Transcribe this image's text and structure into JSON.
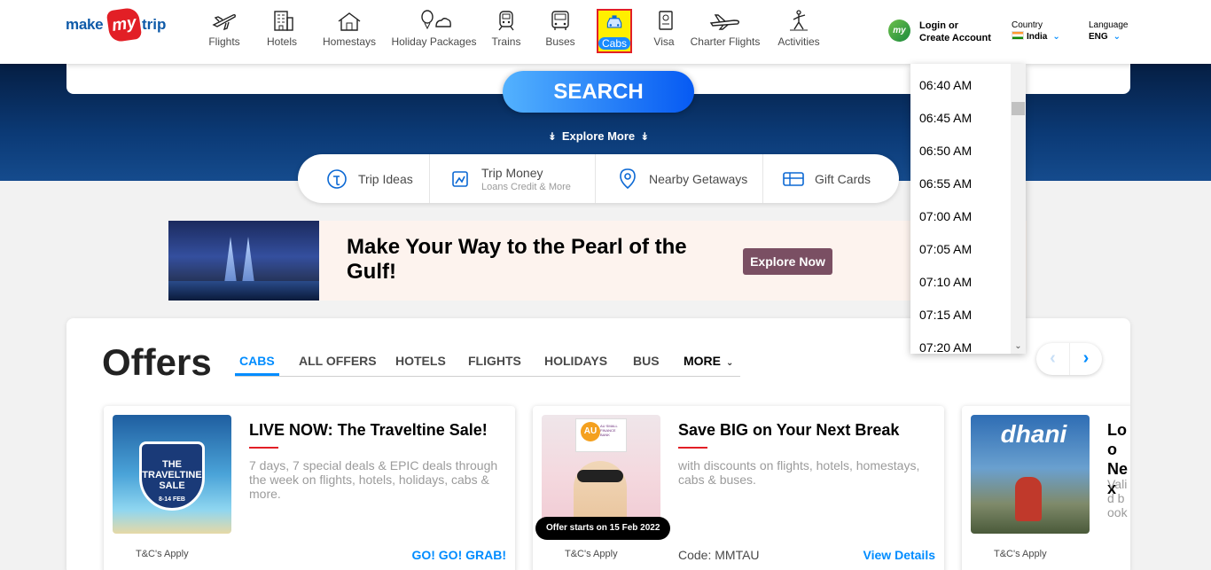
{
  "brand": {
    "make": "make",
    "my": "my",
    "trip": "trip"
  },
  "nav": [
    {
      "id": "flights",
      "label": "Flights",
      "icon": "flight-icon"
    },
    {
      "id": "hotels",
      "label": "Hotels",
      "icon": "hotel-icon"
    },
    {
      "id": "homestays",
      "label": "Homestays",
      "icon": "homestay-icon"
    },
    {
      "id": "holiday",
      "label": "Holiday Packages",
      "icon": "holiday-icon"
    },
    {
      "id": "trains",
      "label": "Trains",
      "icon": "train-icon"
    },
    {
      "id": "buses",
      "label": "Buses",
      "icon": "bus-icon"
    },
    {
      "id": "cabs",
      "label": "Cabs",
      "icon": "cab-icon"
    },
    {
      "id": "visa",
      "label": "Visa",
      "icon": "visa-icon"
    },
    {
      "id": "charter",
      "label": "Charter Flights",
      "icon": "charter-flight-icon"
    },
    {
      "id": "activities",
      "label": "Activities",
      "icon": "activities-icon"
    }
  ],
  "account": {
    "line1": "Login or",
    "line2": "Create Account",
    "avatar": "my"
  },
  "country": {
    "caption": "Country",
    "value": "India"
  },
  "language": {
    "caption": "Language",
    "value": "ENG"
  },
  "search": {
    "label": "SEARCH"
  },
  "explore": {
    "label": "Explore More"
  },
  "quick_links": [
    {
      "label": "Trip Ideas",
      "sub": ""
    },
    {
      "label": "Trip Money",
      "sub": "Loans Credit & More"
    },
    {
      "label": "Nearby Getaways",
      "sub": ""
    },
    {
      "label": "Gift Cards",
      "sub": ""
    }
  ],
  "banner": {
    "headline": "Make Your Way to the Pearl of the Gulf!",
    "cta": "Explore Now"
  },
  "offers": {
    "title": "Offers",
    "tabs": [
      "CABS",
      "ALL OFFERS",
      "HOTELS",
      "FLIGHTS",
      "HOLIDAYS",
      "BUS",
      "MORE"
    ],
    "active_tab": "CABS",
    "cards": [
      {
        "title": "LIVE NOW: The Traveltine Sale!",
        "desc": "7 days, 7 special deals & EPIC deals through the week on flights, hotels, holidays, cabs & more.",
        "tnc": "T&C's Apply",
        "code": "",
        "link": "GO! GO! GRAB!",
        "pill": "",
        "thumb_text": "THE TRAVELTINE SALE",
        "thumb_sub": "8-14 FEB"
      },
      {
        "title": "Save BIG on Your Next Break",
        "desc": "with discounts on flights, hotels, homestays, cabs & buses.",
        "tnc": "T&C's Apply",
        "code": "Code: MMTAU",
        "link": "View Details",
        "pill": "Offer starts on 15 Feb 2022",
        "thumb_text": "AU",
        "thumb_sub": "AU SMALL FINANCE BANK"
      },
      {
        "title": "Loo Nex",
        "desc": "Valid book",
        "tnc": "T&C's Apply",
        "code": "",
        "link": "",
        "pill": "",
        "thumb_text": "dhani",
        "thumb_sub": ""
      }
    ]
  },
  "time_dropdown": {
    "options": [
      "06:40 AM",
      "06:45 AM",
      "06:50 AM",
      "06:55 AM",
      "07:00 AM",
      "07:05 AM",
      "07:10 AM",
      "07:15 AM",
      "07:20 AM"
    ]
  },
  "colors": {
    "brand_blue": "#0f5aa8",
    "brand_red": "#e21f26",
    "accent": "#008cff",
    "cta_purple": "#7a4f63"
  }
}
